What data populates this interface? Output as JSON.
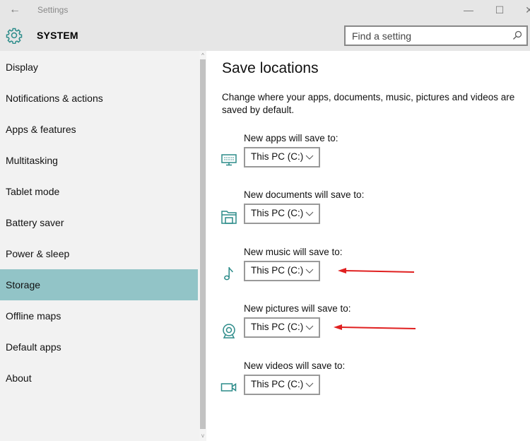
{
  "window": {
    "title": "Settings",
    "back_icon": "arrow-left-icon",
    "controls": {
      "minimize": "—",
      "maximize": "☐",
      "close": "✕"
    }
  },
  "header": {
    "icon": "gear-icon",
    "section": "SYSTEM",
    "search": {
      "placeholder": "Find a setting",
      "value": "",
      "icon": "search-icon"
    }
  },
  "sidebar": {
    "items": [
      {
        "label": "Display"
      },
      {
        "label": "Notifications & actions"
      },
      {
        "label": "Apps & features"
      },
      {
        "label": "Multitasking"
      },
      {
        "label": "Tablet mode"
      },
      {
        "label": "Battery saver"
      },
      {
        "label": "Power & sleep"
      },
      {
        "label": "Storage",
        "selected": true
      },
      {
        "label": "Offline maps"
      },
      {
        "label": "Default apps"
      },
      {
        "label": "About"
      }
    ],
    "selected_color": "#92c4c7"
  },
  "main": {
    "title": "Save locations",
    "description": "Change where your apps, documents, music, pictures and videos are saved by default.",
    "accent_color": "#2b8b89",
    "locations": [
      {
        "label": "New apps will save to:",
        "value": "This PC (C:)",
        "icon": "monitor-icon"
      },
      {
        "label": "New documents will save to:",
        "value": "This PC (C:)",
        "icon": "documents-folder-icon"
      },
      {
        "label": "New music will save to:",
        "value": "This PC (C:)",
        "icon": "music-note-icon"
      },
      {
        "label": "New pictures will save to:",
        "value": "This PC (C:)",
        "icon": "camera-icon"
      },
      {
        "label": "New videos will save to:",
        "value": "This PC (C:)",
        "icon": "video-camera-icon"
      }
    ]
  },
  "annotations": {
    "arrow_color": "#e02020",
    "arrows_point_to": [
      "music",
      "pictures"
    ]
  }
}
